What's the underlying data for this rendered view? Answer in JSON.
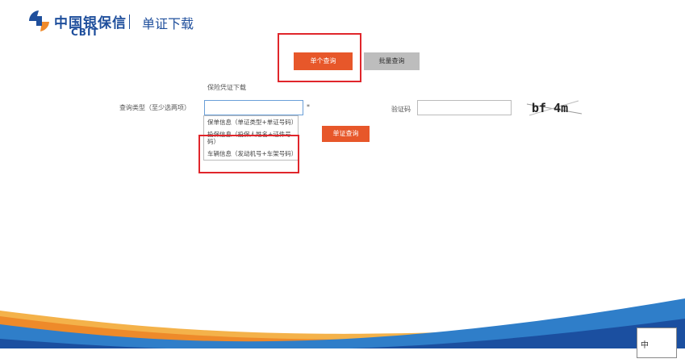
{
  "header": {
    "logo_cn": "中国银保信",
    "logo_en": "CBIT",
    "title": "单证下载"
  },
  "modes": {
    "single": "单个查询",
    "batch": "批量查询"
  },
  "form": {
    "section_label": "保险凭证下载",
    "query_type_label": "查询类型（至少选两项）",
    "query_type_value": "",
    "required_mark": "*",
    "options": [
      "保单信息（单证类型+单证号码）",
      "投保信息（投保人姓名+证件号码）",
      "车辆信息（发动机号+车架号码）"
    ],
    "query_button": "单证查询",
    "captcha_label": "验证码",
    "captcha_value": "",
    "captcha_text": "bf 4m"
  },
  "footer": {
    "widget_text": "中"
  },
  "colors": {
    "brand_blue": "#1f4f9c",
    "accent_orange": "#e7572a",
    "highlight_red": "#e0262b"
  }
}
